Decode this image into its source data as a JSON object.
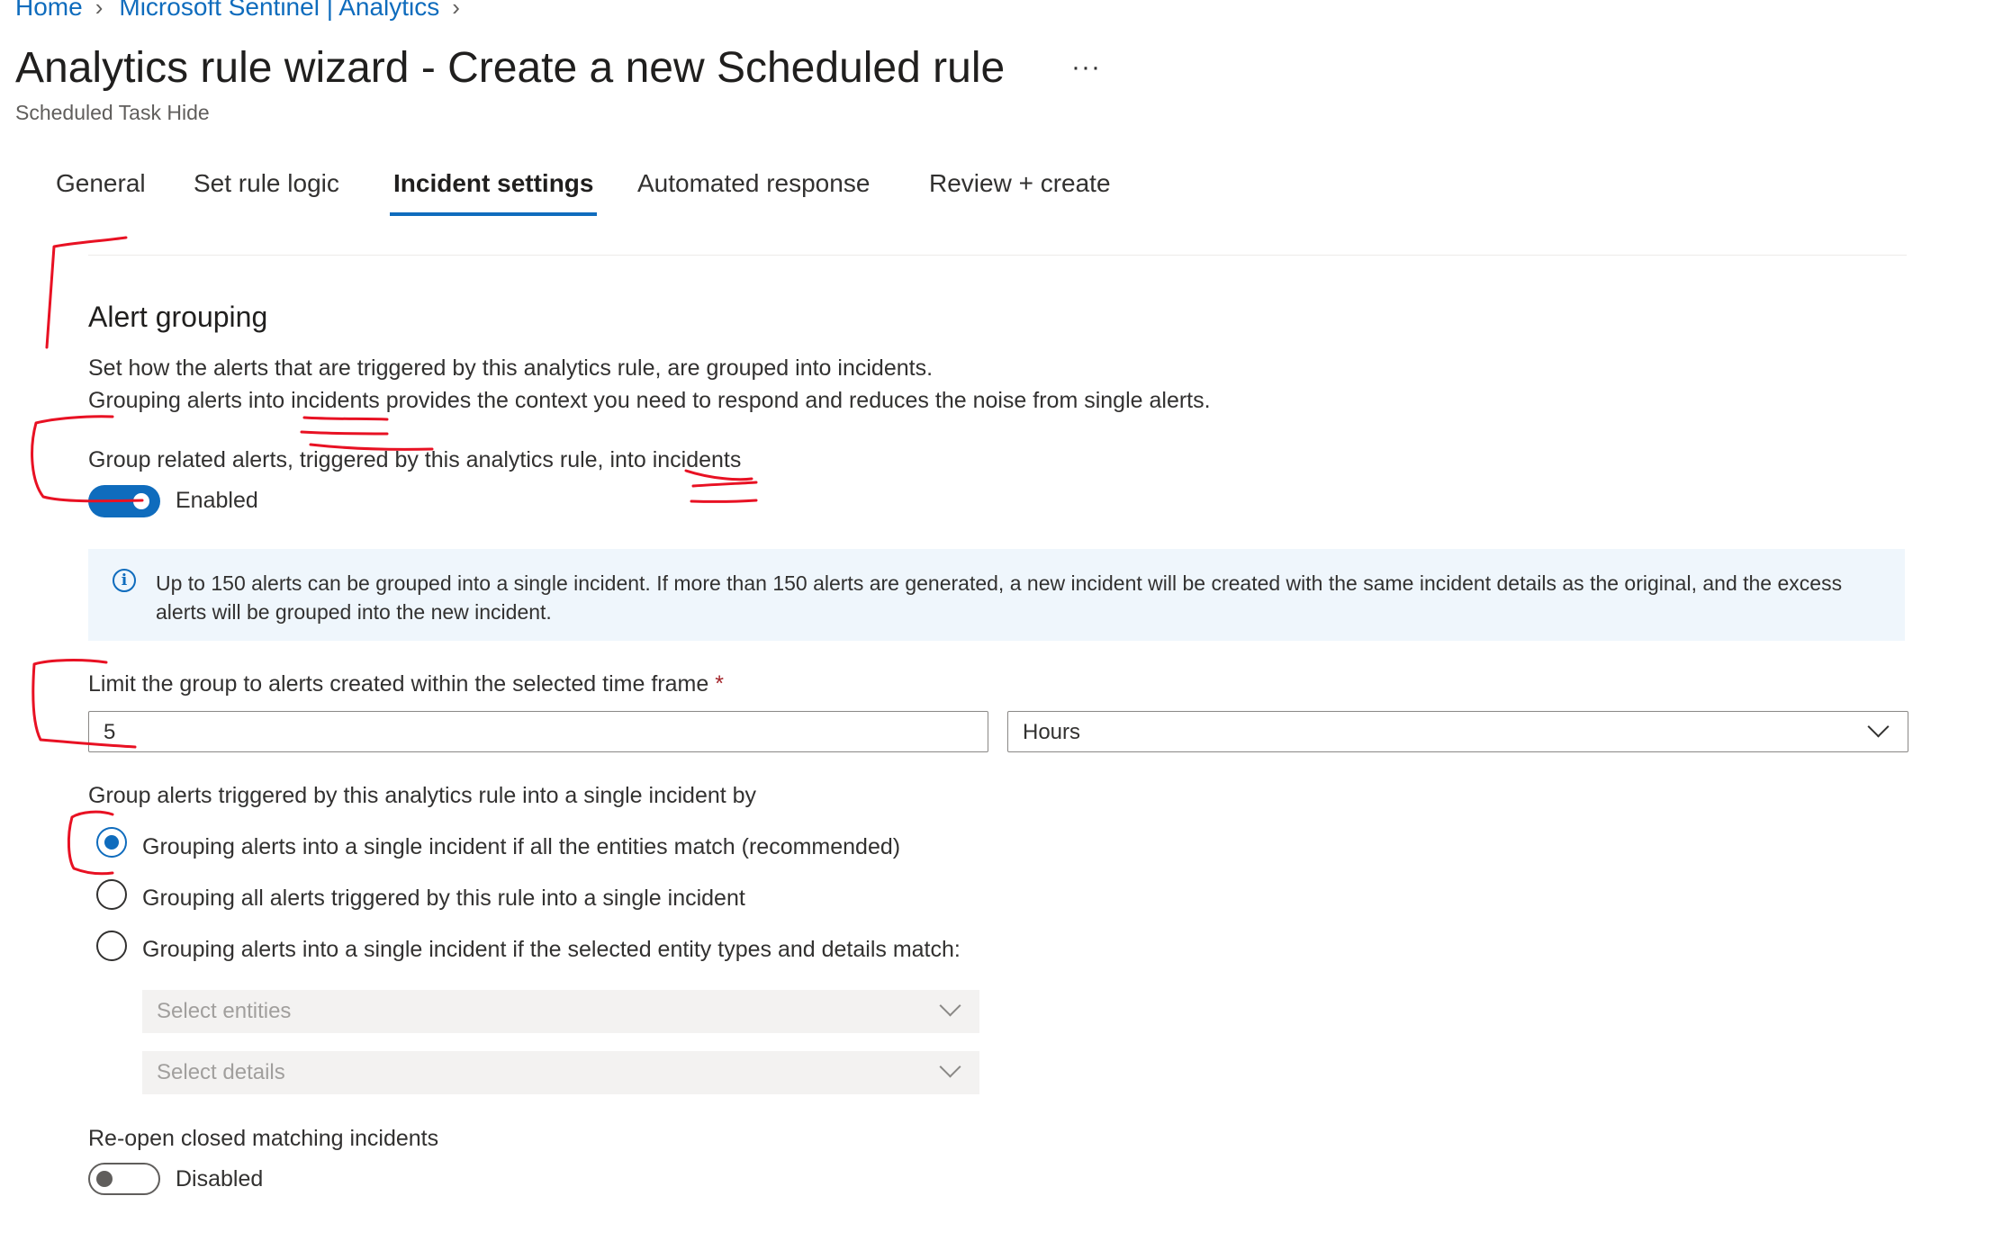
{
  "breadcrumb": {
    "items": [
      "Home",
      "Microsoft Sentinel | Analytics"
    ]
  },
  "page": {
    "title": "Analytics rule wizard - Create a new Scheduled rule",
    "more": "···",
    "subtitle": "Scheduled Task Hide"
  },
  "tabs": [
    {
      "label": "General"
    },
    {
      "label": "Set rule logic"
    },
    {
      "label": "Incident settings",
      "active": true
    },
    {
      "label": "Automated response"
    },
    {
      "label": "Review + create"
    }
  ],
  "alert_grouping": {
    "heading": "Alert grouping",
    "desc_line1": "Set how the alerts that are triggered by this analytics rule, are grouped into incidents.",
    "desc_line2": "Grouping alerts into incidents provides the context you need to respond and reduces the noise from single alerts.",
    "group_label": "Group related alerts, triggered by this analytics rule, into incidents",
    "group_toggle_state": "Enabled",
    "info": "Up to 150 alerts can be grouped into a single incident. If more than 150 alerts are generated, a new incident will be created with the same incident details as the original, and the excess alerts will be grouped into the new incident.",
    "limit_label": "Limit the group to alerts created within the selected time frame",
    "limit_required": "*",
    "limit_value": "5",
    "limit_unit": "Hours",
    "group_by_label": "Group alerts triggered by this analytics rule into a single incident by",
    "options": [
      {
        "label": "Grouping alerts into a single incident if all the entities match (recommended)",
        "checked": true
      },
      {
        "label": "Grouping all alerts triggered by this rule into a single incident",
        "checked": false
      },
      {
        "label": "Grouping alerts into a single incident if the selected entity types and details match:",
        "checked": false
      }
    ],
    "select_entities_placeholder": "Select entities",
    "select_details_placeholder": "Select details",
    "reopen_label": "Re-open closed matching incidents",
    "reopen_toggle_state": "Disabled"
  },
  "colors": {
    "accent": "#0f6cbd",
    "annotation": "#e81123",
    "info_bg": "#eff6fc"
  }
}
